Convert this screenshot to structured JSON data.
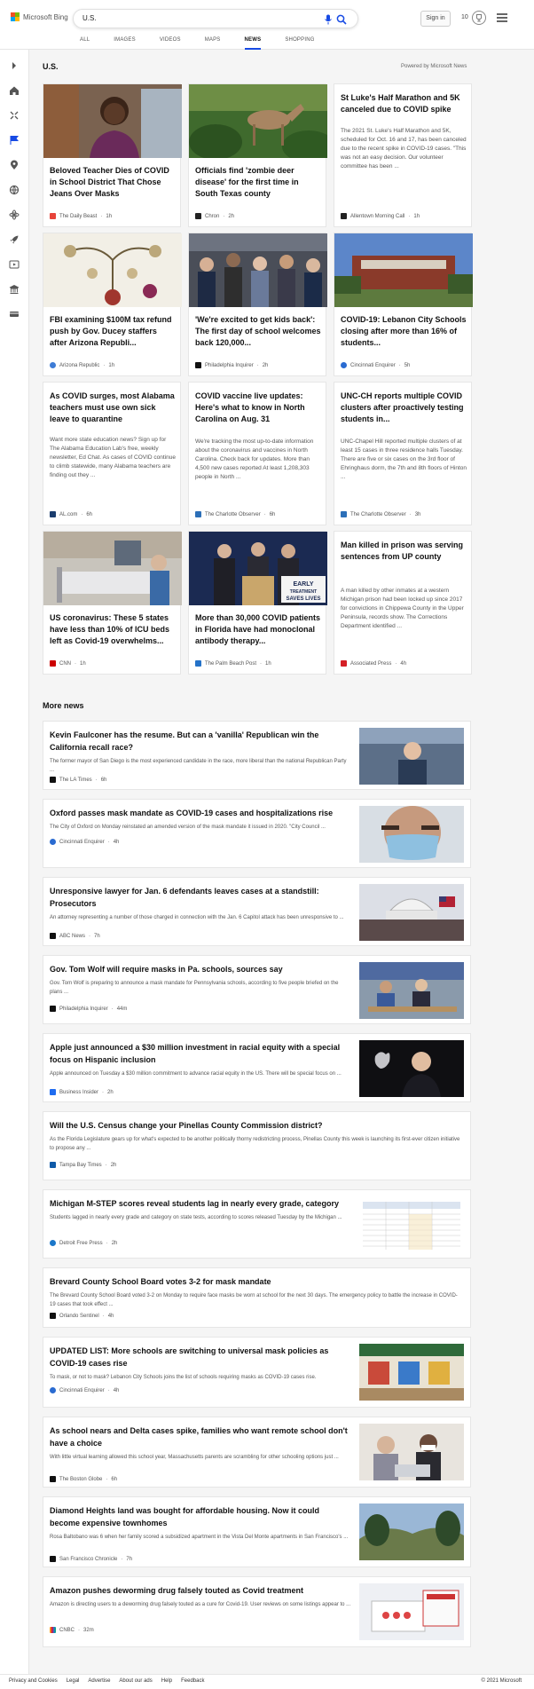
{
  "brand": {
    "name": "Microsoft Bing"
  },
  "search": {
    "query": "U.S."
  },
  "header": {
    "signin_label": "Sign in",
    "rewards_count": "10"
  },
  "tabs": [
    "ALL",
    "IMAGES",
    "VIDEOS",
    "MAPS",
    "NEWS",
    "SHOPPING"
  ],
  "active_tab": "NEWS",
  "section": {
    "title": "U.S.",
    "powered": "Powered by Microsoft News"
  },
  "cards": [
    {
      "title": "Beloved Teacher Dies of COVID in School District That Chose Jeans Over Masks",
      "snippet": "",
      "source": "The Daily Beast",
      "time": "1h"
    },
    {
      "title": "Officials find 'zombie deer disease' for the first time in South Texas county",
      "snippet": "",
      "source": "Chron",
      "time": "2h"
    },
    {
      "title": "St Luke's Half Marathon and 5K canceled due to COVID spike",
      "snippet": "The 2021 St. Luke's Half Marathon and 5K, scheduled for Oct. 16 and 17, has been canceled due to the recent spike in COVID-19 cases. \"This was not an easy decision. Our volunteer committee has been ...",
      "source": "Allentown Morning Call",
      "time": "1h"
    },
    {
      "title": "FBI examining $100M tax refund push by Gov. Ducey staffers after Arizona Republi...",
      "snippet": "",
      "source": "Arizona Republic",
      "time": "1h"
    },
    {
      "title": "'We're excited to get kids back': The first day of school welcomes back 120,000...",
      "snippet": "",
      "source": "Philadelphia Inquirer",
      "time": "2h"
    },
    {
      "title": "COVID-19: Lebanon City Schools closing after more than 16% of students...",
      "snippet": "",
      "source": "Cincinnati Enquirer",
      "time": "5h"
    },
    {
      "title": "As COVID surges, most Alabama teachers must use own sick leave to quarantine",
      "snippet": "Want more state education news? Sign up for The Alabama Education Lab's free, weekly newsletter, Ed Chat. As cases of COVID continue to climb statewide, many Alabama teachers are finding out they ...",
      "source": "AL.com",
      "time": "6h"
    },
    {
      "title": "COVID vaccine live updates: Here's what to know in North Carolina on Aug. 31",
      "snippet": "We're tracking the most up-to-date information about the coronavirus and vaccines in North Carolina. Check back for updates. More than 4,500 new cases reported At least 1,208,303 people in North ...",
      "source": "The Charlotte Observer",
      "time": "6h"
    },
    {
      "title": "UNC-CH reports multiple COVID clusters after proactively testing students in...",
      "snippet": "UNC-Chapel Hill reported multiple clusters of at least 15 cases in three residence halls Tuesday. There are five or six cases on the 3rd floor of Ehringhaus dorm, the 7th and 8th floors of Hinton ...",
      "source": "The Charlotte Observer",
      "time": "3h"
    },
    {
      "title": "US coronavirus: These 5 states have less than 10% of ICU beds left as Covid-19 overwhelms...",
      "snippet": "",
      "source": "CNN",
      "time": "1h"
    },
    {
      "title": "More than 30,000 COVID patients in Florida have had monoclonal antibody therapy...",
      "snippet": "",
      "source": "The Palm Beach Post",
      "time": "1h"
    },
    {
      "title": "Man killed in prison was serving sentences from UP county",
      "snippet": "A man killed by other inmates at a western Michigan prison had been locked up since 2017 for convictions in Chippewa County in the Upper Peninsula, records show. The Corrections Department identified ...",
      "source": "Associated Press",
      "time": "4h"
    }
  ],
  "more_news_title": "More news",
  "more_news": [
    {
      "title": "Kevin Faulconer has the resume. But can a 'vanilla' Republican win the California recall race?",
      "snippet": "The former mayor of San Diego is the most experienced candidate in the race, more liberal than the national Republican Party ...",
      "source": "The LA Times",
      "time": "6h"
    },
    {
      "title": "Oxford passes mask mandate as COVID-19 cases and hospitalizations rise",
      "snippet": "The City of Oxford on Monday reinstated an amended version of the mask mandate it issued in 2020. \"City Council ...",
      "source": "Cincinnati Enquirer",
      "time": "4h"
    },
    {
      "title": "Unresponsive lawyer for Jan. 6 defendants leaves cases at a standstill: Prosecutors",
      "snippet": "An attorney representing a number of those charged in connection with the Jan. 6 Capitol attack has been unresponsive to ...",
      "source": "ABC News",
      "time": "7h"
    },
    {
      "title": "Gov. Tom Wolf will require masks in Pa. schools, sources say",
      "snippet": "Gov. Tom Wolf is preparing to announce a mask mandate for Pennsylvania schools, according to five people briefed on the plans ...",
      "source": "Philadelphia Inquirer",
      "time": "44m"
    },
    {
      "title": "Apple just announced a $30 million investment in racial equity with a special focus on Hispanic inclusion",
      "snippet": "Apple announced on Tuesday a $30 million commitment to advance racial equity in the US. There will be special focus on ...",
      "source": "Business Insider",
      "time": "2h"
    },
    {
      "title": "Will the U.S. Census change your Pinellas County Commission district?",
      "snippet": "As the Florida Legislature gears up for what's expected to be another politically thorny redistricting process, Pinellas County this week is launching its first-ever citizen initiative to propose any ...",
      "source": "Tampa Bay Times",
      "time": "2h"
    },
    {
      "title": "Michigan M-STEP scores reveal students lag in nearly every grade, category",
      "snippet": "Students lagged in nearly every grade and category on state tests, according to scores released Tuesday by the Michigan ...",
      "source": "Detroit Free Press",
      "time": "2h"
    },
    {
      "title": "Brevard County School Board votes 3-2 for mask mandate",
      "snippet": "The Brevard County School Board voted 3-2 on Monday to require face masks be worn at school for the next 30 days. The emergency policy to battle the increase in COVID-19 cases that took effect ...",
      "source": "Orlando Sentinel",
      "time": "4h"
    },
    {
      "title": "UPDATED LIST: More schools are switching to universal mask policies as COVID-19 cases rise",
      "snippet": "To mask, or not to mask? Lebanon City Schools joins the list of schools requiring masks as COVID-19 cases rise.",
      "source": "Cincinnati Enquirer",
      "time": "4h"
    },
    {
      "title": "As school nears and Delta cases spike, families who want remote school don't have a choice",
      "snippet": "With little virtual learning allowed this school year, Massachusetts parents are scrambling for other schooling options just ...",
      "source": "The Boston Globe",
      "time": "6h"
    },
    {
      "title": "Diamond Heights land was bought for affordable housing. Now it could become expensive townhomes",
      "snippet": "Rosa Baltobano was 6 when her family scored a subsidized apartment in the Vista Del Monte apartments in San Francisco's ...",
      "source": "San Francisco Chronicle",
      "time": "7h"
    },
    {
      "title": "Amazon pushes deworming drug falsely touted as Covid treatment",
      "snippet": "Amazon is directing users to a deworming drug falsely touted as a cure for Covid-19. User reviews on some listings appear to ...",
      "source": "CNBC",
      "time": "32m"
    }
  ],
  "footer": {
    "links": [
      "Privacy and Cookies",
      "Legal",
      "Advertise",
      "About our ads",
      "Help",
      "Feedback"
    ],
    "copyright": "© 2021 Microsoft"
  },
  "colors": {
    "accent": "#174ae4",
    "ms_red": "#f25022",
    "ms_green": "#7fba00",
    "ms_blue": "#00a4ef",
    "ms_yellow": "#ffb900"
  }
}
